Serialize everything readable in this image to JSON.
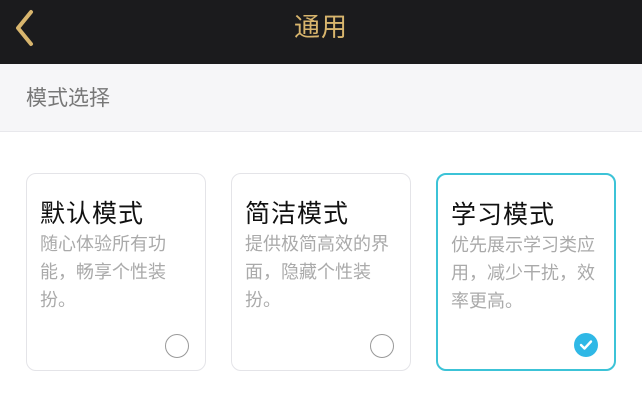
{
  "header": {
    "title": "通用",
    "back_icon": "chevron-left-icon",
    "accent_color": "#d8b56d",
    "background": "#1b1b1d"
  },
  "section": {
    "title": "模式选择"
  },
  "modes": [
    {
      "title": "默认模式",
      "description": "随心体验所有功能，畅享个性装扮。",
      "selected": false
    },
    {
      "title": "简洁模式",
      "description": "提供极简高效的界面，隐藏个性装扮。",
      "selected": false
    },
    {
      "title": "学习模式",
      "description": "优先展示学习类应用，减少干扰，效率更高。",
      "selected": true
    }
  ],
  "colors": {
    "selected_border": "#3cc3d7",
    "check_fill": "#2fb8e6"
  }
}
